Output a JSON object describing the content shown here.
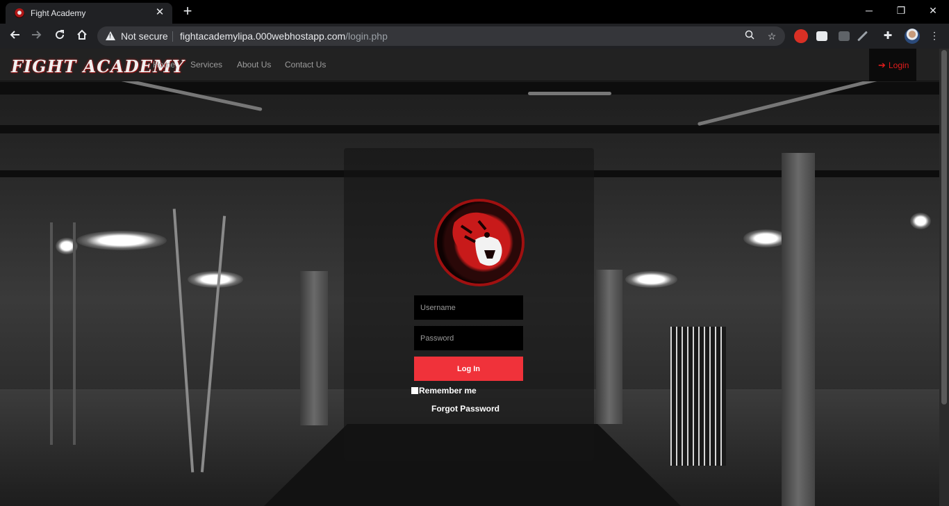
{
  "browser": {
    "tab_title": "Fight Academy",
    "tab_close": "✕",
    "new_tab": "+",
    "security_label": "Not secure",
    "url_host": "fightacademylipa.000webhostapp.com",
    "url_path": "/login.php",
    "window_controls": {
      "minimize": "─",
      "restore": "❐",
      "close": "✕"
    }
  },
  "site": {
    "brand": "FIGHT ACADEMY",
    "nav": [
      "Home",
      "Services",
      "About Us",
      "Contact Us"
    ],
    "login_label": "Login",
    "login_icon": "➔"
  },
  "form": {
    "username_placeholder": "Username",
    "password_placeholder": "Password",
    "submit_label": "Log In",
    "remember_label": "Remember me",
    "forgot_label": "Forgot Password"
  },
  "colors": {
    "accent_red": "#f0323a",
    "nav_bg": "#222222",
    "login_red": "#e21c1c"
  },
  "icons": [
    "back-arrow-icon",
    "forward-arrow-icon",
    "reload-icon",
    "home-icon",
    "warning-icon",
    "zoom-icon",
    "star-icon",
    "extension-puzzle-icon",
    "profile-avatar-icon",
    "tiger-logo-icon",
    "login-arrow-icon"
  ]
}
